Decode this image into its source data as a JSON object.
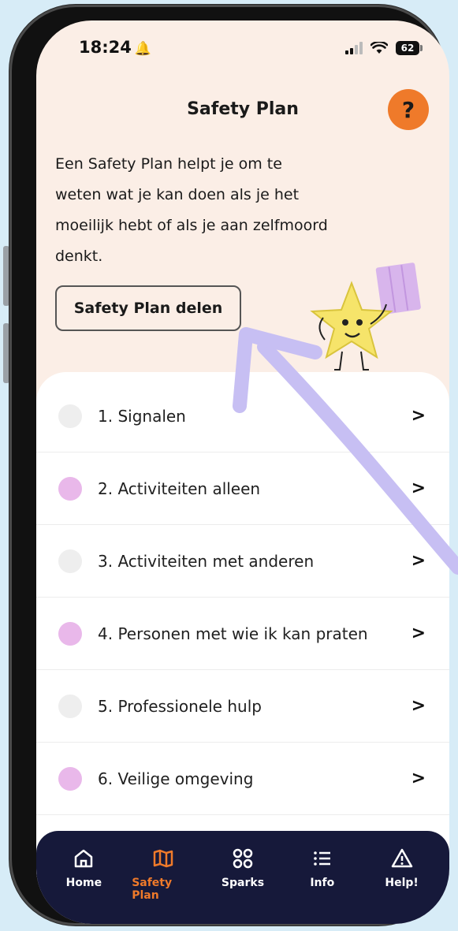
{
  "status_bar": {
    "time": "18:24",
    "battery": "62"
  },
  "header": {
    "title": "Safety Plan",
    "help_label": "?"
  },
  "intro": {
    "text": "Een Safety Plan helpt je om te weten wat je kan doen als je het moeilijk hebt of als je aan zelfmoord denkt.",
    "share_button": "Safety Plan delen"
  },
  "list": [
    {
      "label": "1. Signalen",
      "dot_color": "#eeeeee"
    },
    {
      "label": "2. Activiteiten alleen",
      "dot_color": "#e9b8ea"
    },
    {
      "label": "3. Activiteiten met anderen",
      "dot_color": "#eeeeee"
    },
    {
      "label": "4. Personen met wie ik kan praten",
      "dot_color": "#e9b8ea"
    },
    {
      "label": "5. Professionele hulp",
      "dot_color": "#eeeeee"
    },
    {
      "label": "6. Veilige omgeving",
      "dot_color": "#e9b8ea"
    }
  ],
  "tabbar": {
    "tabs": [
      {
        "label": "Home",
        "icon": "home-icon"
      },
      {
        "label": "Safety Plan",
        "icon": "map-icon",
        "active": true
      },
      {
        "label": "Sparks",
        "icon": "grid-icon"
      },
      {
        "label": "Info",
        "icon": "list-icon"
      },
      {
        "label": "Help!",
        "icon": "warning-icon"
      }
    ]
  },
  "colors": {
    "accent": "#ef7a2a",
    "header_bg": "#fbeee6",
    "tabbar_bg": "#16193a",
    "annotation_arrow": "#c7bff3",
    "background": "#d7ecf7"
  }
}
